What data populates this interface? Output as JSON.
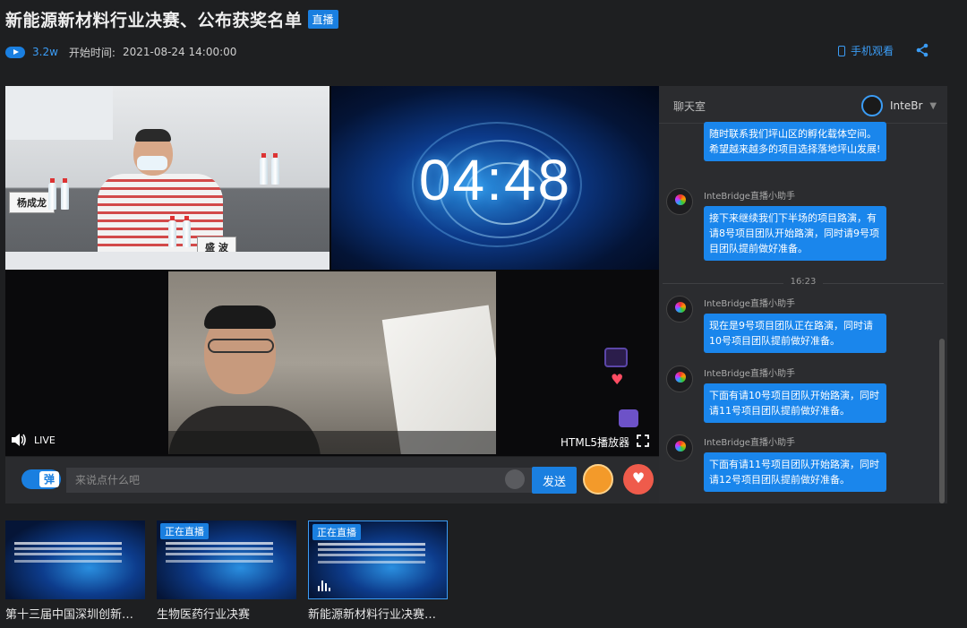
{
  "header": {
    "title": "新能源新材料行业决赛、公布获奖名单",
    "live_badge": "直播",
    "views": "3.2w",
    "start_label": "开始时间:",
    "start_time": "2021-08-24 14:00:00",
    "mobile_label": "手机观看"
  },
  "player": {
    "timer": "04:48",
    "nameplate_left": "杨成龙",
    "nameplate_right": "盛 波",
    "live_label": "LIVE",
    "player_label": "HTML5播放器"
  },
  "comment_bar": {
    "danmu_label": "弹",
    "placeholder": "来说点什么吧",
    "send_label": "发送"
  },
  "chat": {
    "title": "聊天室",
    "username": "InteBr",
    "time_separator": "16:23",
    "messages": [
      {
        "name": "",
        "text": "随时联系我们坪山区的孵化载体空间。希望越来越多的项目选择落地坪山发展!"
      },
      {
        "name": "InteBridge直播小助手",
        "text": "接下来继续我们下半场的项目路演，有请8号项目团队开始路演，同时请9号项目团队提前做好准备。"
      },
      {
        "name": "InteBridge直播小助手",
        "text": "现在是9号项目团队正在路演，同时请10号项目团队提前做好准备。"
      },
      {
        "name": "InteBridge直播小助手",
        "text": "下面有请10号项目团队开始路演，同时请11号项目团队提前做好准备。"
      },
      {
        "name": "InteBridge直播小助手",
        "text": "下面有请11号项目团队开始路演，同时请12号项目团队提前做好准备。"
      }
    ]
  },
  "related": [
    {
      "badge": "",
      "title": "第十三届中国深圳创新…"
    },
    {
      "badge": "正在直播",
      "title": "生物医药行业决赛"
    },
    {
      "badge": "正在直播",
      "title": "新能源新材料行业决赛…"
    }
  ],
  "colors": {
    "accent": "#1a7fe0",
    "link": "#3b9cf5",
    "background": "#1e1f21"
  }
}
